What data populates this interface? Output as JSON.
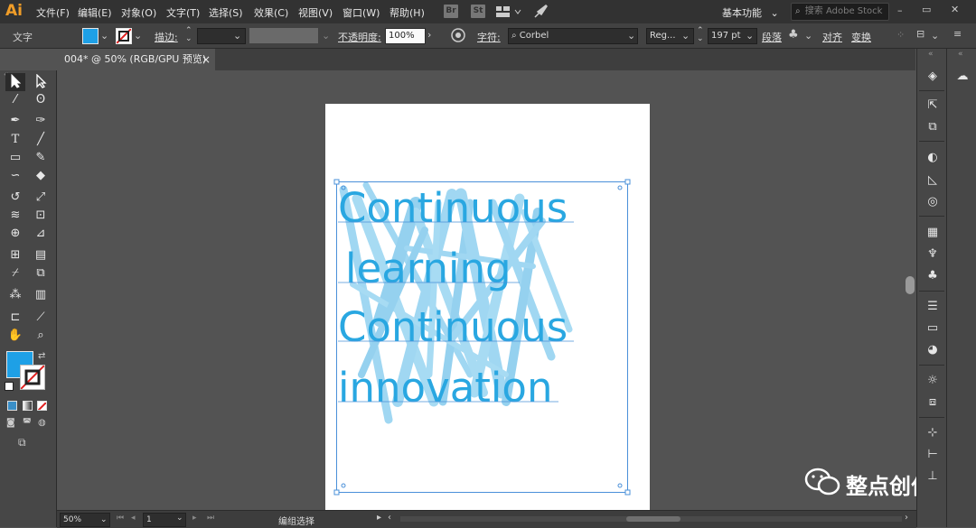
{
  "app": {
    "logo": "Ai"
  },
  "menu": [
    "文件(F)",
    "编辑(E)",
    "对象(O)",
    "文字(T)",
    "选择(S)",
    "效果(C)",
    "视图(V)",
    "窗口(W)",
    "帮助(H)"
  ],
  "app_icons": {
    "bridge": "Br",
    "stock": "St"
  },
  "workspace": {
    "label": "基本功能"
  },
  "search": {
    "placeholder": "搜索 Adobe Stock"
  },
  "window_controls": {
    "minimize": "–",
    "restore": "▭",
    "close": "✕"
  },
  "control_bar": {
    "mode_label": "文字",
    "fill_color": "#1ea0e6",
    "stroke_label": "描边:",
    "opacity_label": "不透明度:",
    "opacity_value": "100%",
    "char_label": "字符:",
    "font_name": "Corbel",
    "font_style": "Reg...",
    "font_size": "197 pt",
    "paragraph_label": "段落",
    "align_label": "对齐",
    "transform_label": "变换"
  },
  "document_tab": {
    "title": "004* @ 50% (RGB/GPU 预览)",
    "close": "×"
  },
  "artboard": {
    "lines": [
      "Continuous",
      "learning",
      "Continuous",
      "innovation"
    ],
    "text_color": "#29a7e1"
  },
  "toolbar": {
    "tools": [
      "selection",
      "direct-selection",
      "magic-wand",
      "lasso",
      "pen",
      "curvature",
      "type",
      "line",
      "rectangle",
      "paintbrush",
      "shaper",
      "eraser",
      "rotate",
      "scale",
      "width",
      "free-transform",
      "shape-builder",
      "perspective",
      "mesh",
      "gradient",
      "eyedropper",
      "blend",
      "symbol-sprayer",
      "column-graph",
      "artboard",
      "slice",
      "hand",
      "zoom"
    ],
    "fill_color": "#1ea0e6"
  },
  "status_bar": {
    "zoom": "50%",
    "page": "1",
    "status_text": "编组选择"
  },
  "watermark": {
    "text": "整点创作"
  }
}
